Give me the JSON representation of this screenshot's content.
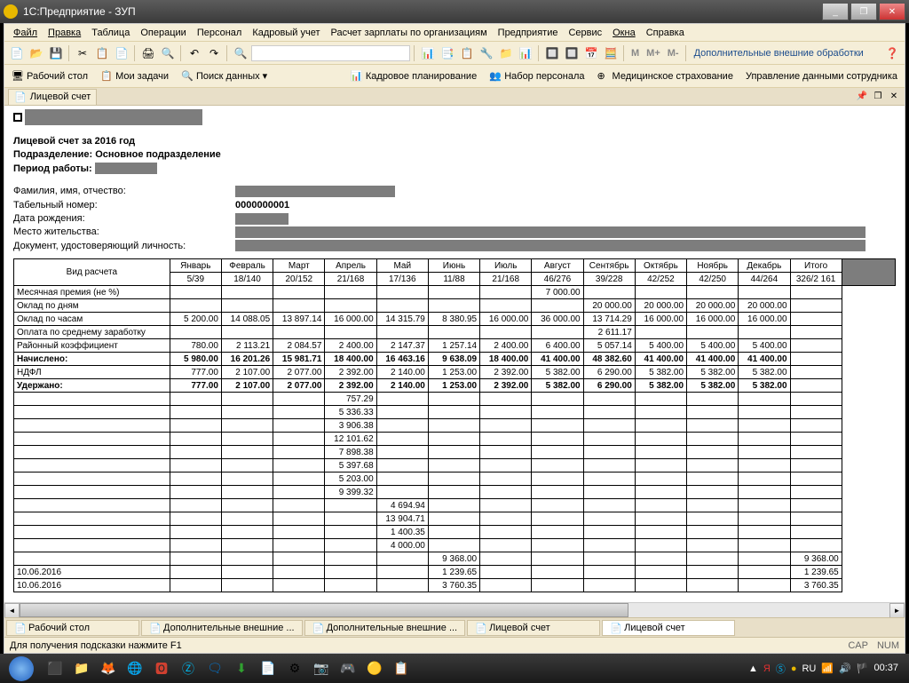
{
  "window": {
    "title": "1С:Предприятие - ЗУП"
  },
  "menu": [
    "Файл",
    "Правка",
    "Таблица",
    "Операции",
    "Персонал",
    "Кадровый учет",
    "Расчет зарплаты по организациям",
    "Предприятие",
    "Сервис",
    "Окна",
    "Справка"
  ],
  "toolbar": {
    "m_labels": [
      "М",
      "М+",
      "М-"
    ],
    "extra_link": "Дополнительные внешние обработки"
  },
  "nav": {
    "desktop": "Рабочий стол",
    "tasks": "Мои задачи",
    "search": "Поиск данных",
    "planning": "Кадровое планирование",
    "recruit": "Набор персонала",
    "medical": "Медицинское страхование",
    "employee_data": "Управление данными сотрудника"
  },
  "tab": {
    "title": "Лицевой счет"
  },
  "doc": {
    "title1": "Лицевой счет за 2016 год",
    "title2": "Подразделение: Основное подразделение",
    "title3_label": "Период работы:",
    "fio_label": "Фамилия, имя, отчество:",
    "tabnum_label": "Табельный номер:",
    "tabnum_value": "0000000001",
    "birth_label": "Дата рождения:",
    "address_label": "Место жительства:",
    "docid_label": "Документ, удостоверяющий личность:"
  },
  "table": {
    "col_type": "Вид расчета",
    "months": [
      {
        "name": "Январь",
        "sub": "5/39"
      },
      {
        "name": "Февраль",
        "sub": "18/140"
      },
      {
        "name": "Март",
        "sub": "20/152"
      },
      {
        "name": "Апрель",
        "sub": "21/168"
      },
      {
        "name": "Май",
        "sub": "17/136"
      },
      {
        "name": "Июнь",
        "sub": "11/88"
      },
      {
        "name": "Июль",
        "sub": "21/168"
      },
      {
        "name": "Август",
        "sub": "46/276"
      },
      {
        "name": "Сентябрь",
        "sub": "39/228"
      },
      {
        "name": "Октябрь",
        "sub": "42/252"
      },
      {
        "name": "Ноябрь",
        "sub": "42/250"
      },
      {
        "name": "Декабрь",
        "sub": "44/264"
      }
    ],
    "total": {
      "name": "Итого",
      "sub": "326/2 161"
    },
    "rows": [
      {
        "label": "Месячная премия (не %)",
        "vals": [
          "",
          "",
          "",
          "",
          "",
          "",
          "",
          "7 000.00",
          "",
          "",
          "",
          ""
        ]
      },
      {
        "label": "Оклад по дням",
        "vals": [
          "",
          "",
          "",
          "",
          "",
          "",
          "",
          "",
          "20 000.00",
          "20 000.00",
          "20 000.00",
          "20 000.00"
        ]
      },
      {
        "label": "Оклад по часам",
        "vals": [
          "5 200.00",
          "14 088.05",
          "13 897.14",
          "16 000.00",
          "14 315.79",
          "8 380.95",
          "16 000.00",
          "36 000.00",
          "13 714.29",
          "16 000.00",
          "16 000.00",
          "16 000.00"
        ]
      },
      {
        "label": "Оплата по среднему заработку",
        "vals": [
          "",
          "",
          "",
          "",
          "",
          "",
          "",
          "",
          "2 611.17",
          "",
          "",
          ""
        ]
      },
      {
        "label": "Районный коэффициент",
        "vals": [
          "780.00",
          "2 113.21",
          "2 084.57",
          "2 400.00",
          "2 147.37",
          "1 257.14",
          "2 400.00",
          "6 400.00",
          "5 057.14",
          "5 400.00",
          "5 400.00",
          "5 400.00"
        ]
      },
      {
        "label": "Начислено:",
        "bold": true,
        "vals": [
          "5 980.00",
          "16 201.26",
          "15 981.71",
          "18 400.00",
          "16 463.16",
          "9 638.09",
          "18 400.00",
          "41 400.00",
          "48 382.60",
          "41 400.00",
          "41 400.00",
          "41 400.00"
        ]
      },
      {
        "label": "НДФЛ",
        "vals": [
          "777.00",
          "2 107.00",
          "2 077.00",
          "2 392.00",
          "2 140.00",
          "1 253.00",
          "2 392.00",
          "5 382.00",
          "6 290.00",
          "5 382.00",
          "5 382.00",
          "5 382.00"
        ]
      },
      {
        "label": "Удержано:",
        "bold": true,
        "vals": [
          "777.00",
          "2 107.00",
          "2 077.00",
          "2 392.00",
          "2 140.00",
          "1 253.00",
          "2 392.00",
          "5 382.00",
          "6 290.00",
          "5 382.00",
          "5 382.00",
          "5 382.00"
        ]
      },
      {
        "label": "",
        "vals": [
          "",
          "",
          "",
          "757.29",
          "",
          "",
          "",
          "",
          "",
          "",
          "",
          ""
        ]
      },
      {
        "label": "",
        "vals": [
          "",
          "",
          "",
          "5 336.33",
          "",
          "",
          "",
          "",
          "",
          "",
          "",
          ""
        ]
      },
      {
        "label": "",
        "vals": [
          "",
          "",
          "",
          "3 906.38",
          "",
          "",
          "",
          "",
          "",
          "",
          "",
          ""
        ]
      },
      {
        "label": "",
        "vals": [
          "",
          "",
          "",
          "12 101.62",
          "",
          "",
          "",
          "",
          "",
          "",
          "",
          ""
        ]
      },
      {
        "label": "",
        "vals": [
          "",
          "",
          "",
          "7 898.38",
          "",
          "",
          "",
          "",
          "",
          "",
          "",
          ""
        ]
      },
      {
        "label": "",
        "vals": [
          "",
          "",
          "",
          "5 397.68",
          "",
          "",
          "",
          "",
          "",
          "",
          "",
          ""
        ]
      },
      {
        "label": "",
        "vals": [
          "",
          "",
          "",
          "5 203.00",
          "",
          "",
          "",
          "",
          "",
          "",
          "",
          ""
        ]
      },
      {
        "label": "",
        "vals": [
          "",
          "",
          "",
          "9 399.32",
          "",
          "",
          "",
          "",
          "",
          "",
          "",
          ""
        ]
      },
      {
        "label": "",
        "vals": [
          "",
          "",
          "",
          "",
          "4 694.94",
          "",
          "",
          "",
          "",
          "",
          "",
          ""
        ]
      },
      {
        "label": "",
        "vals": [
          "",
          "",
          "",
          "",
          "13 904.71",
          "",
          "",
          "",
          "",
          "",
          "",
          ""
        ]
      },
      {
        "label": "",
        "vals": [
          "",
          "",
          "",
          "",
          "1 400.35",
          "",
          "",
          "",
          "",
          "",
          "",
          ""
        ]
      },
      {
        "label": "",
        "vals": [
          "",
          "",
          "",
          "",
          "4 000.00",
          "",
          "",
          "",
          "",
          "",
          "",
          ""
        ]
      },
      {
        "label": "",
        "vals": [
          "",
          "",
          "",
          "",
          "",
          "9 368.00",
          "",
          "",
          "",
          "",
          "",
          ""
        ],
        "total": "9 368.00"
      },
      {
        "label": "10.06.2016",
        "vals": [
          "",
          "",
          "",
          "",
          "",
          "1 239.65",
          "",
          "",
          "",
          "",
          "",
          ""
        ],
        "total": "1 239.65"
      },
      {
        "label": "10.06.2016",
        "vals": [
          "",
          "",
          "",
          "",
          "",
          "3 760.35",
          "",
          "",
          "",
          "",
          "",
          ""
        ],
        "total": "3 760.35"
      }
    ]
  },
  "bottom_tabs": [
    "Рабочий стол",
    "Дополнительные внешние ...",
    "Дополнительные внешние ...",
    "Лицевой счет",
    "Лицевой счет"
  ],
  "status": {
    "help": "Для получения подсказки нажмите F1",
    "cap": "CAP",
    "num": "NUM"
  },
  "taskbar": {
    "lang": "RU",
    "time": "00:37"
  }
}
